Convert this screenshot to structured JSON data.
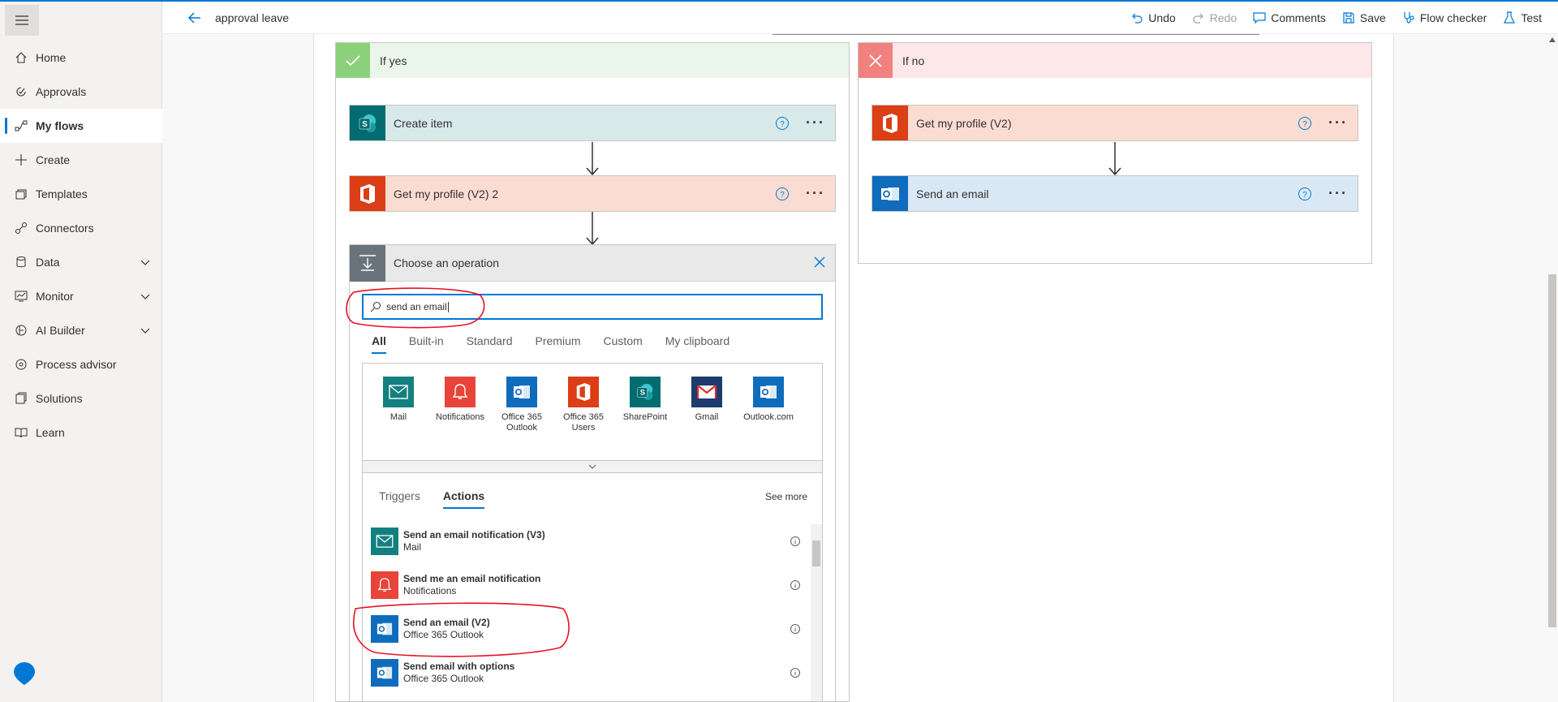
{
  "app": {
    "flow_title": "approval leave"
  },
  "toolbar": {
    "undo": "Undo",
    "redo": "Redo",
    "comments": "Comments",
    "save": "Save",
    "flow_checker": "Flow checker",
    "test": "Test"
  },
  "sidebar": {
    "items": [
      {
        "label": "Home",
        "icon": "home-icon"
      },
      {
        "label": "Approvals",
        "icon": "approvals-icon"
      },
      {
        "label": "My flows",
        "icon": "flows-icon",
        "active": true
      },
      {
        "label": "Create",
        "icon": "plus-icon"
      },
      {
        "label": "Templates",
        "icon": "templates-icon"
      },
      {
        "label": "Connectors",
        "icon": "connectors-icon"
      },
      {
        "label": "Data",
        "icon": "database-icon",
        "expandable": true
      },
      {
        "label": "Monitor",
        "icon": "monitor-icon",
        "expandable": true
      },
      {
        "label": "AI Builder",
        "icon": "ai-builder-icon",
        "expandable": true
      },
      {
        "label": "Process advisor",
        "icon": "process-advisor-icon"
      },
      {
        "label": "Solutions",
        "icon": "solutions-icon"
      },
      {
        "label": "Learn",
        "icon": "learn-icon"
      }
    ]
  },
  "branches": {
    "yes": {
      "title": "If yes",
      "actions": [
        {
          "label": "Create item",
          "icon": "sharepoint-icon",
          "color": "#036c70",
          "bg": "#d8e9ea"
        },
        {
          "label": "Get my profile (V2) 2",
          "icon": "office-icon",
          "color": "#dc3e15",
          "bg": "#fbdcd2"
        }
      ]
    },
    "no": {
      "title": "If no",
      "actions": [
        {
          "label": "Get my profile (V2)",
          "icon": "office-icon",
          "color": "#dc3e15",
          "bg": "#fbdcd2"
        },
        {
          "label": "Send an email",
          "icon": "outlook-icon",
          "color": "#0f6cbd",
          "bg": "#dae8f6"
        }
      ]
    }
  },
  "choose_operation": {
    "title": "Choose an operation",
    "search_value": "send an email",
    "tabs": [
      "All",
      "Built-in",
      "Standard",
      "Premium",
      "Custom",
      "My clipboard"
    ],
    "connectors": [
      {
        "name": "Mail",
        "color": "#13807f",
        "icon": "mail-icon"
      },
      {
        "name": "Notifications",
        "color": "#e8443a",
        "icon": "bell-icon"
      },
      {
        "name": "Office 365 Outlook",
        "color": "#0f6cbd",
        "icon": "outlook-icon"
      },
      {
        "name": "Office 365 Users",
        "color": "#dc3e15",
        "icon": "office-icon"
      },
      {
        "name": "SharePoint",
        "color": "#036c70",
        "icon": "sharepoint-icon"
      },
      {
        "name": "Gmail",
        "color": "#1c3b6e",
        "icon": "gmail-icon"
      },
      {
        "name": "Outlook.com",
        "color": "#0f6cbd",
        "icon": "outlook-icon"
      }
    ],
    "subtabs": [
      "Triggers",
      "Actions"
    ],
    "see_more": "See more",
    "actions": [
      {
        "name": "Send an email notification (V3)",
        "connector": "Mail",
        "color": "#13807f",
        "icon": "mail-icon"
      },
      {
        "name": "Send me an email notification",
        "connector": "Notifications",
        "color": "#e8443a",
        "icon": "bell-icon"
      },
      {
        "name": "Send an email (V2)",
        "connector": "Office 365 Outlook",
        "color": "#0f6cbd",
        "icon": "outlook-icon"
      },
      {
        "name": "Send email with options",
        "connector": "Office 365 Outlook",
        "color": "#0f6cbd",
        "icon": "outlook-icon"
      }
    ]
  },
  "colors": {
    "accent": "#0078d4",
    "annotation": "#e81123"
  }
}
